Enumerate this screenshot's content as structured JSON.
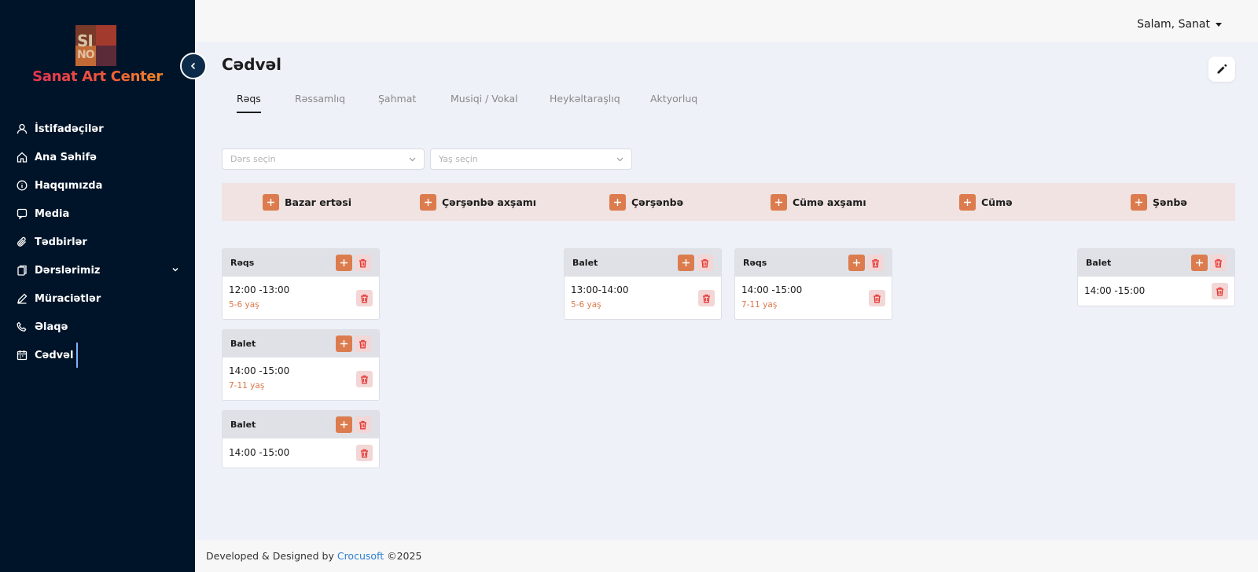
{
  "brand": {
    "name": "Sanat Art Center",
    "logo_text_top": "SI",
    "logo_text_bottom": "NO"
  },
  "colors": {
    "sidebar_bg": "#001429",
    "accent": "#dc7c4e",
    "danger": "#e53935",
    "day_bar_bg": "#f0e3e1",
    "link": "#2f7fd1"
  },
  "nav": [
    {
      "label": "İstifadəçilər",
      "icon": "user-icon"
    },
    {
      "label": "Ana Səhifə",
      "icon": "home-icon"
    },
    {
      "label": "Haqqımızda",
      "icon": "info-icon"
    },
    {
      "label": "Media",
      "icon": "media-icon"
    },
    {
      "label": "Tədbirlər",
      "icon": "paperclip-icon"
    },
    {
      "label": "Dərslərimiz",
      "icon": "copy-icon"
    },
    {
      "label": "Müraciətlər",
      "icon": "pen-icon"
    },
    {
      "label": "Əlaqə",
      "icon": "phone-icon"
    },
    {
      "label": "Cədvəl",
      "icon": "calendar-icon"
    }
  ],
  "header": {
    "greeting": "Salam, Sanat"
  },
  "page": {
    "title": "Cədvəl"
  },
  "tabs": [
    "Rəqs",
    "Rəssamlıq",
    "Şahmat",
    "Musiqi / Vokal",
    "Heykəltaraşlıq",
    "Aktyorluq"
  ],
  "filters": {
    "lesson_placeholder": "Dərs seçin",
    "age_placeholder": "Yaş seçin"
  },
  "days": [
    "Bazar ertəsi",
    "Çərşənbə axşamı",
    "Çərşənbə",
    "Cümə axşamı",
    "Cümə",
    "Şənbə"
  ],
  "cards": {
    "c1": {
      "name": "Rəqs",
      "time": "12:00 -13:00",
      "age": "5-6 yaş"
    },
    "c2": {
      "name": "Balet",
      "time": "14:00 -15:00",
      "age": "7-11 yaş"
    },
    "c3": {
      "name": "Balet",
      "time": "14:00 -15:00"
    },
    "c4": {
      "name": "Balet",
      "time": "13:00-14:00",
      "age": "5-6 yaş"
    },
    "c5": {
      "name": "Rəqs",
      "time": "14:00 -15:00",
      "age": "7-11 yaş"
    },
    "c6": {
      "name": "Balet",
      "time": "14:00 -15:00"
    }
  },
  "footer": {
    "prefix": "Developed & Designed by ",
    "company": "Crocusoft",
    "suffix": " ©2025"
  }
}
